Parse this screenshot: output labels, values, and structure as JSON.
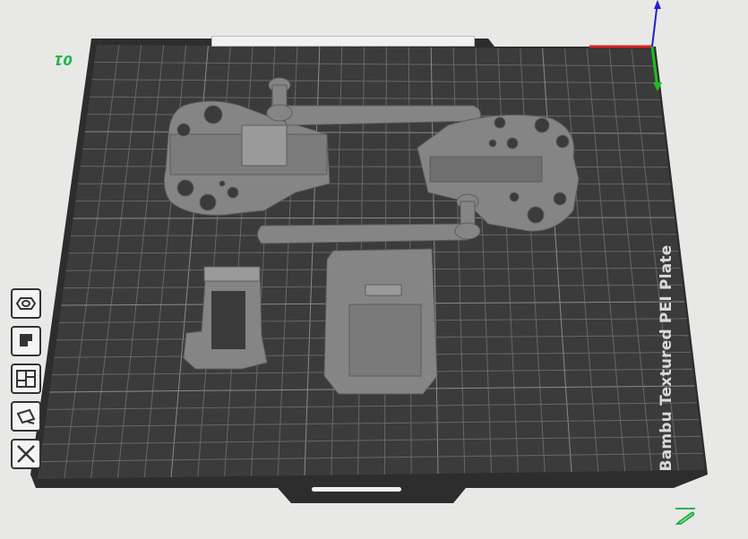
{
  "plate": {
    "label": "Bambu Textured PEI Plate",
    "number": "01"
  },
  "toolbar": {
    "items": [
      {
        "name": "orient-icon"
      },
      {
        "name": "auto-arrange-icon"
      },
      {
        "name": "layout-icon"
      },
      {
        "name": "slice-plate-icon"
      },
      {
        "name": "delete-plate-icon"
      }
    ]
  },
  "edit": {
    "icon": "pencil-icon"
  },
  "colors": {
    "background": "#e8e8e6",
    "plate": "#3a3a3a",
    "grid": "#5a5a5a",
    "part": "#8a8a8a",
    "axis_x": "#d22",
    "axis_y": "#2b2",
    "axis_z": "#22c",
    "accent": "#1fb54a"
  }
}
